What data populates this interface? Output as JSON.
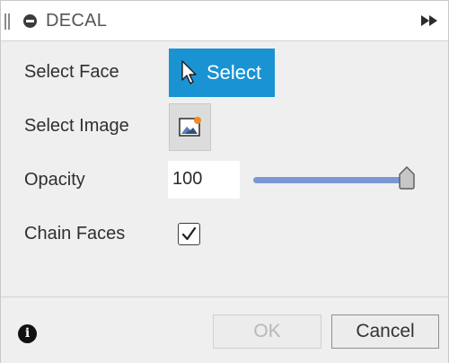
{
  "header": {
    "title": "DECAL",
    "icons": [
      "panel-grip-icon",
      "collapse-icon",
      "fast-forward-icon"
    ]
  },
  "rows": {
    "select_face": {
      "label": "Select Face",
      "button_label": "Select",
      "button_icon": "cursor-arrow-icon"
    },
    "select_image": {
      "label": "Select Image",
      "button_icon": "image-icon"
    },
    "opacity": {
      "label": "Opacity",
      "value": "100",
      "slider_value": 100
    },
    "chain_faces": {
      "label": "Chain Faces",
      "checked": true
    }
  },
  "footer": {
    "info_glyph": "i",
    "ok_label": "OK",
    "cancel_label": "Cancel"
  },
  "colors": {
    "accent": "#1a93d3",
    "slider_track": "#7b98d4",
    "panel_bg": "#efefef"
  }
}
